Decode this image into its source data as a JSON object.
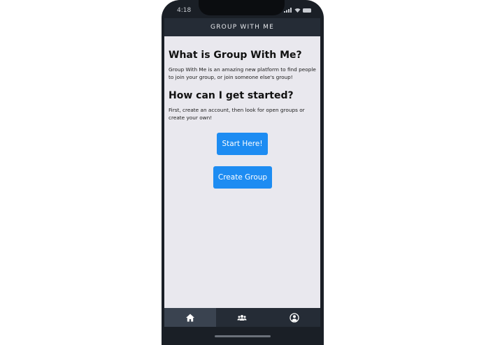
{
  "status_bar": {
    "time": "4:18"
  },
  "header": {
    "title": "GROUP WITH ME"
  },
  "main": {
    "section1": {
      "heading": "What is Group With Me?",
      "body": "Group With Me is an amazing new platform to find people to join your group, or join someone else's group!"
    },
    "section2": {
      "heading": "How can I get started?",
      "body": "First, create an account, then look for open groups or create your own!"
    },
    "buttons": {
      "start_label": "Start Here!",
      "create_label": "Create Group"
    }
  },
  "tab_bar": {
    "tabs": [
      {
        "icon": "home-icon",
        "active": true
      },
      {
        "icon": "group-icon",
        "active": false
      },
      {
        "icon": "profile-icon",
        "active": false
      }
    ]
  },
  "colors": {
    "accent": "#1d8cf2",
    "header_bg": "#252c36",
    "content_bg": "#e9e8ee",
    "active_tab_bg": "#3a4350"
  }
}
